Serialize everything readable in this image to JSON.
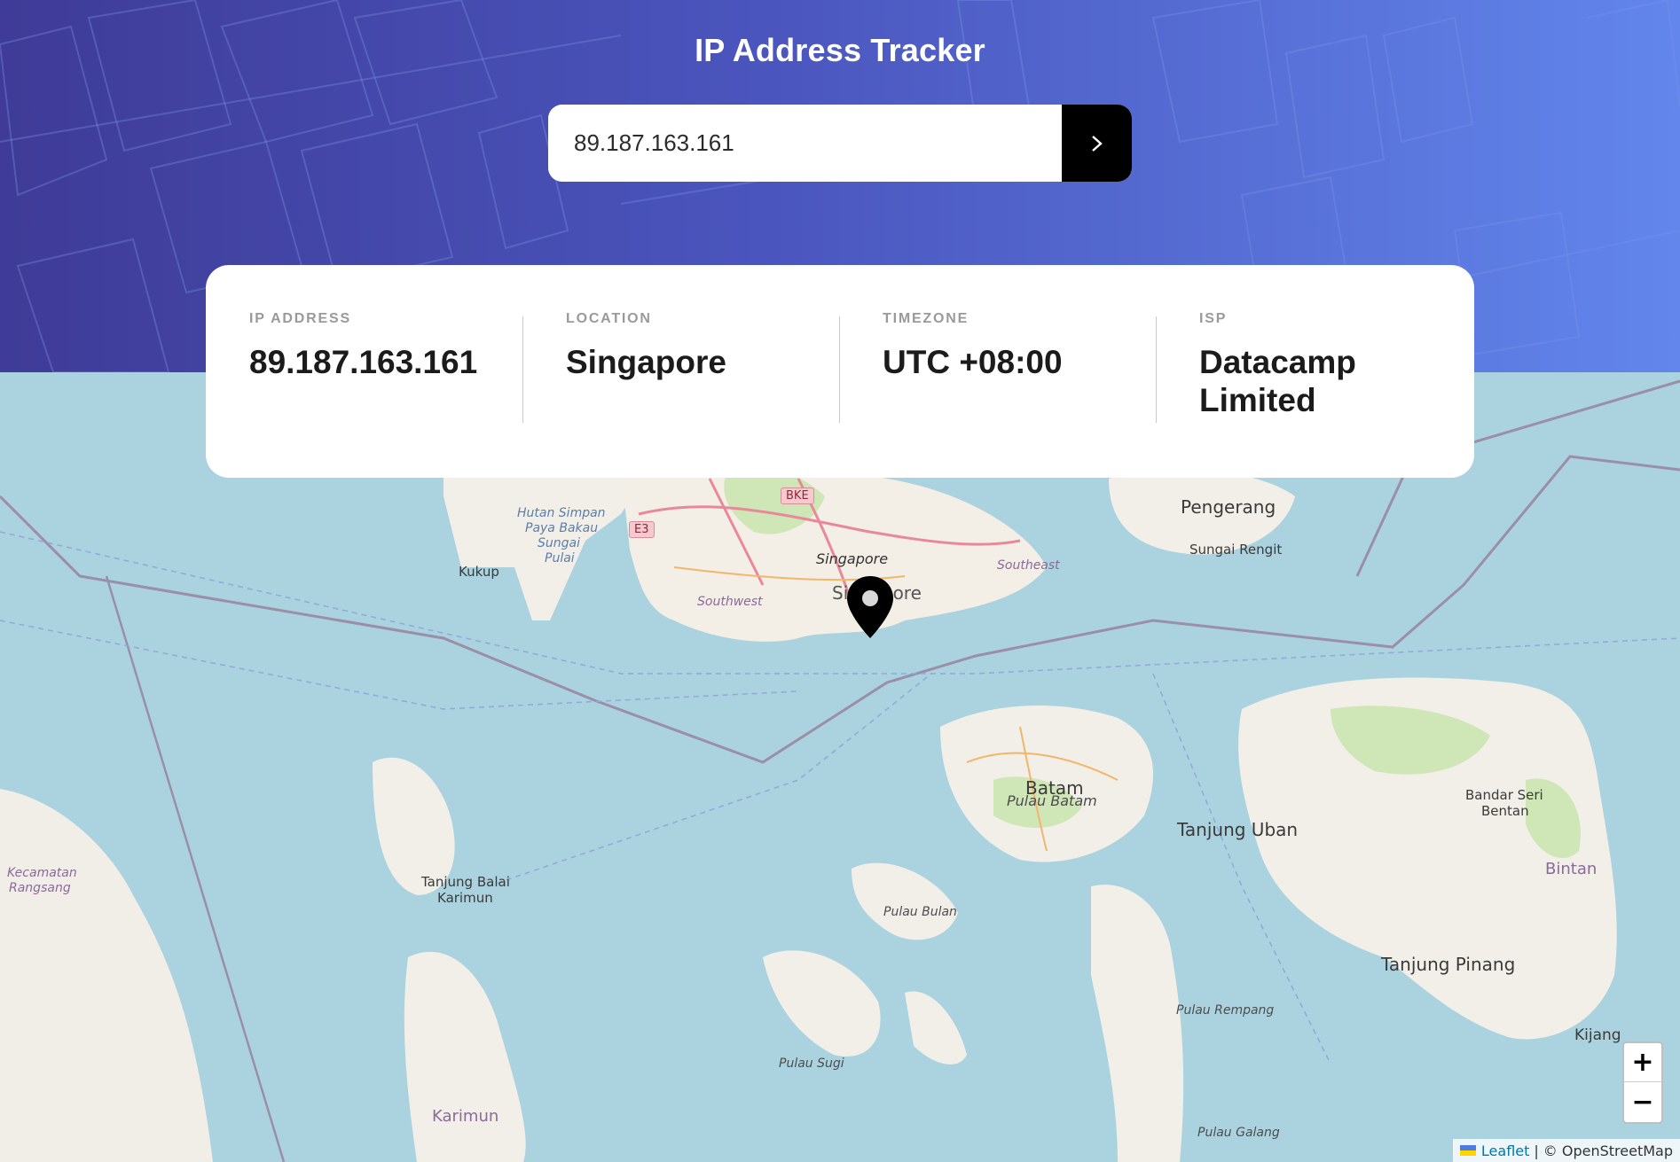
{
  "header": {
    "title": "IP Address Tracker"
  },
  "search": {
    "value": "89.187.163.161",
    "button_label": ">"
  },
  "info": [
    {
      "label": "IP ADDRESS",
      "value": "89.187.163.161"
    },
    {
      "label": "LOCATION",
      "value": "Singapore"
    },
    {
      "label": "TIMEZONE",
      "value": "UTC +08:00"
    },
    {
      "label": "ISP",
      "value": "Datacamp Limited"
    }
  ],
  "map": {
    "labels": {
      "singapore": "Singapore",
      "singapore_big": "Singapore",
      "hutan": "Hutan Simpan",
      "paya": "Paya Bakau",
      "sungai": "Sungai",
      "pulai": "Pulai",
      "kukup": "Kukup",
      "southwest": "Southwest",
      "southeast": "Southeast",
      "pengerang": "Pengerang",
      "sungai_rengit": "Sungai Rengit",
      "batam": "Batam",
      "pulau_batam": "Pulau Batam",
      "tanjung_uban": "Tanjung Uban",
      "bandar_seri": "Bandar Seri",
      "bentan": "Bentan",
      "bintan": "Bintan",
      "tanjung_pinang": "Tanjung Pinang",
      "kijang": "Kijang",
      "pulau_bulan": "Pulau Bulan",
      "pulau_rempang": "Pulau Rempang",
      "pulau_galang": "Pulau Galang",
      "pulau_sugi": "Pulau Sugi",
      "karimun": "Karimun",
      "tanjung_balai": "Tanjung Balai",
      "karimun_town": "Karimun",
      "kecamatan": "Kecamatan",
      "rangsang": "Rangsang"
    },
    "road_shields": {
      "bke": "BKE",
      "e3": "E3"
    },
    "zoom_in": "+",
    "zoom_out": "−",
    "attribution": {
      "leaflet": "Leaflet",
      "separator": "|",
      "osm": "© OpenStreetMap"
    }
  }
}
